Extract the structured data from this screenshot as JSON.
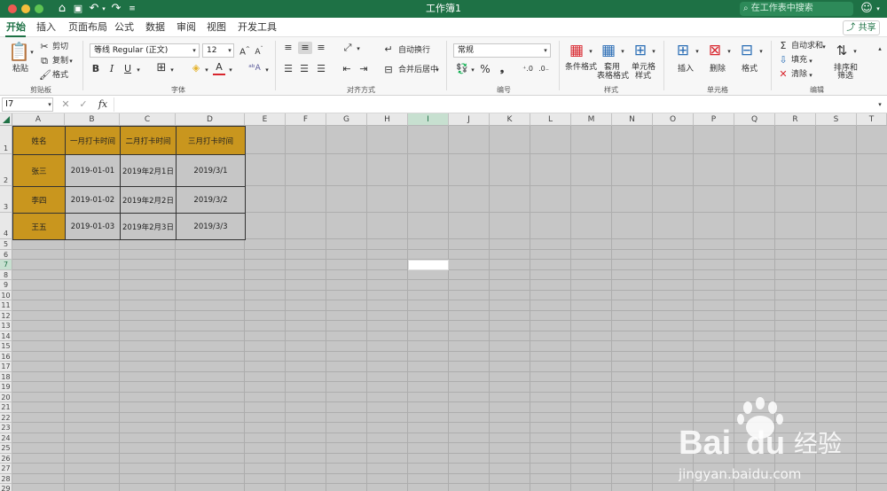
{
  "window": {
    "title": "工作簿1",
    "search_placeholder": "在工作表中搜索"
  },
  "tabs": [
    "开始",
    "插入",
    "页面布局",
    "公式",
    "数据",
    "审阅",
    "视图",
    "开发工具"
  ],
  "share_label": "共享",
  "ribbon": {
    "clipboard": {
      "paste": "粘贴",
      "cut": "剪切",
      "copy": "复制",
      "format": "格式",
      "group": "剪贴板"
    },
    "font": {
      "family": "等线 Regular (正文)",
      "size": "12",
      "group": "字体"
    },
    "align": {
      "wrap": "自动换行",
      "merge": "合并后居中",
      "group": "对齐方式"
    },
    "number": {
      "format": "常规",
      "group": "编号"
    },
    "styles": {
      "conditional": "条件格式",
      "table_fmt_1": "套用",
      "table_fmt_2": "表格格式",
      "cell_style_1": "单元格",
      "cell_style_2": "样式",
      "group": "样式"
    },
    "cells": {
      "insert": "插入",
      "delete": "删除",
      "format": "格式",
      "group": "单元格"
    },
    "edit": {
      "autosum": "自动求和",
      "fill": "填充",
      "clear": "清除",
      "sort_1": "排序和",
      "sort_2": "筛选",
      "group": "编辑"
    }
  },
  "formula_bar": {
    "name_box": "I7",
    "fx": "fx",
    "formula": ""
  },
  "columns": [
    "A",
    "B",
    "C",
    "D",
    "E",
    "F",
    "G",
    "H",
    "I",
    "J",
    "K",
    "L",
    "M",
    "N",
    "O",
    "P",
    "Q",
    "R",
    "S",
    "T"
  ],
  "rows": [
    "1",
    "2",
    "3",
    "4",
    "5",
    "6",
    "7",
    "8",
    "9",
    "10",
    "11",
    "12",
    "13",
    "14",
    "15",
    "16",
    "17",
    "18",
    "19",
    "20",
    "21",
    "22",
    "23",
    "24",
    "25",
    "26",
    "27",
    "28",
    "29"
  ],
  "table": {
    "header": [
      "姓名",
      "一月打卡时间",
      "二月打卡时间",
      "三月打卡时间"
    ],
    "rows": [
      [
        "张三",
        "2019-01-01",
        "2019年2月1日",
        "2019/3/1"
      ],
      [
        "李四",
        "2019-01-02",
        "2019年2月2日",
        "2019/3/2"
      ],
      [
        "王五",
        "2019-01-03",
        "2019年2月3日",
        "2019/3/3"
      ]
    ]
  },
  "watermark": {
    "brand": "Bai",
    "brand_2": "du",
    "cn": "经验",
    "url": "jingyan.baidu.com"
  },
  "colors": {
    "accent": "#1e7145",
    "header_fill": "#c9961e",
    "grid_bg": "#c6c6c6"
  }
}
